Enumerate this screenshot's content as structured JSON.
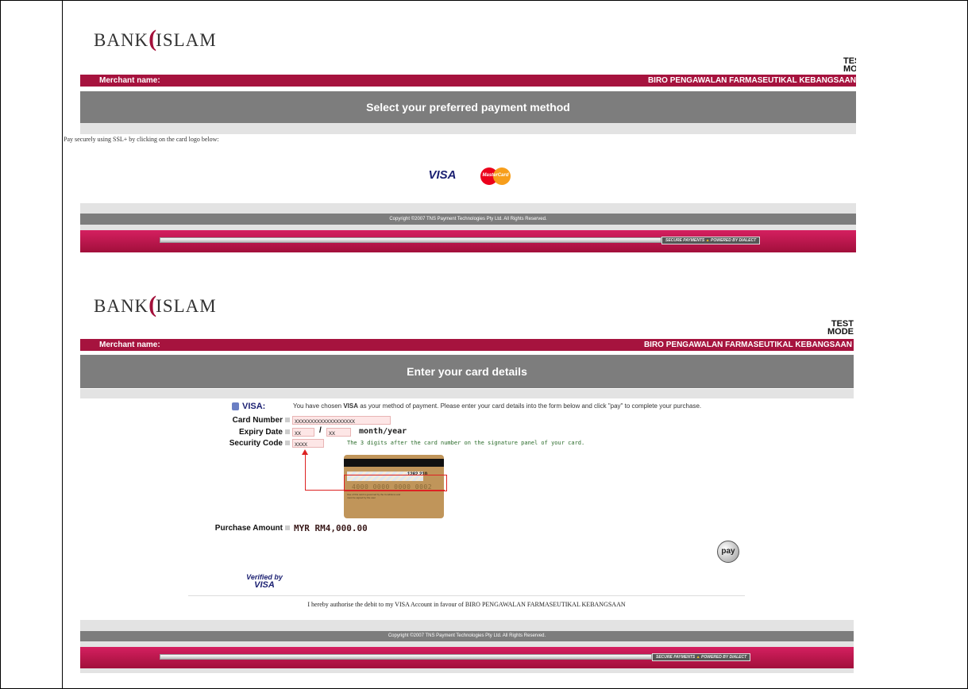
{
  "screen1": {
    "logo_prefix": "BANK",
    "logo_suffix": "ISLAM",
    "test_line1": "TES",
    "test_line2": "MOD",
    "merchant_label": "Merchant name:",
    "merchant_value": "BIRO PENGAWALAN FARMASEUTIKAL KEBANGSAAN",
    "heading": "Select your preferred payment method",
    "instruction": "Pay securely using SSL+ by clicking on the card logo below:",
    "visa_label": "VISA",
    "mastercard_label": "MasterCard",
    "copyright": "Copyright ©2007 TNS Payment Technologies Pty Ltd. All Rights Reserved.",
    "secure_text": "SECURE PAYMENTS",
    "powered_text": "POWERED BY DIALECT"
  },
  "screen2": {
    "logo_prefix": "BANK",
    "logo_suffix": "ISLAM",
    "test_line1": "TEST",
    "test_line2": "MODE",
    "merchant_label": "Merchant name:",
    "merchant_value": "BIRO PENGAWALAN FARMASEUTIKAL KEBANGSAAN",
    "heading": "Enter your card details",
    "card_type": "VISA:",
    "chosen_prefix": "You have chosen ",
    "chosen_card": "VISA",
    "chosen_suffix": " as your method of payment. Please enter your card details into the form below and click \"pay\" to complete your purchase.",
    "card_number_label": "Card Number",
    "card_number_value": "xxxxxxxxxxxxxxxxxxx",
    "expiry_label": "Expiry Date",
    "expiry_month": "xx",
    "expiry_sep": "/",
    "expiry_year": "xx",
    "expiry_hint": "month/year",
    "security_label": "Security Code",
    "security_value": "xxxx",
    "security_hint": "The 3 digits after the card number on the signature panel of your card.",
    "card_image_code": "1282 210",
    "card_image_number": "4000 0000 0000 0002",
    "card_image_terms": "Use of this card is governed by the Conditions and must be signed by the user",
    "purchase_label": "Purchase Amount",
    "purchase_value": "MYR RM4,000.00",
    "pay_button": "pay",
    "verified_by": "Verified by",
    "verified_visa": "VISA",
    "authorise_text": "I hereby authorise the debit to my VISA Account in favour of BIRO PENGAWALAN FARMASEUTIKAL KEBANGSAAN",
    "copyright": "Copyright ©2007 TNS Payment Technologies Pty Ltd. All Rights Reserved.",
    "secure_text": "SECURE PAYMENTS",
    "powered_text": "POWERED BY DIALECT"
  },
  "colors": {
    "brand_crimson": "#a6133e",
    "header_grey": "#7d7d7d",
    "visa_blue": "#1a1f71",
    "form_green": "#2a6b2a"
  }
}
